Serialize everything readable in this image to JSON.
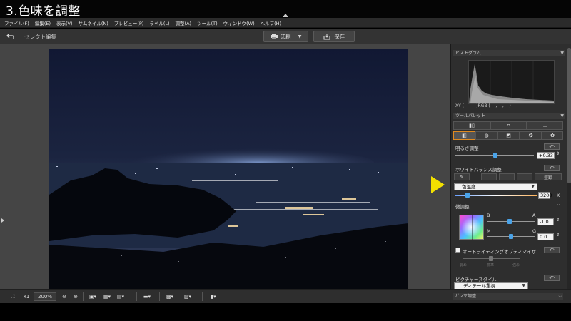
{
  "slide_title": "3.色味を調整",
  "menu": [
    "ファイル(F)",
    "編集(E)",
    "表示(V)",
    "サムネイル(N)",
    "プレビュー(P)",
    "ラベル(L)",
    "調整(A)",
    "ツール(T)",
    "ウィンドウ(W)",
    "ヘルプ(H)"
  ],
  "toolbar": {
    "mode_label": "セレクト編集",
    "print_label": "印刷",
    "save_label": "保存"
  },
  "histogram_panel": {
    "title": "ヒストグラム",
    "readout": "XY (    ,    )RGB (    ,    ,    )"
  },
  "tool_palette": {
    "title": "ツールパレット"
  },
  "brightness": {
    "label": "明るさ調整",
    "value": "+0.33",
    "level": 0.55
  },
  "white_balance": {
    "label": "ホワイトバランス調整",
    "register_label": "登録",
    "mode": "色温度",
    "temp_value": "3200",
    "temp_unit": "K",
    "temp_level": 0.12
  },
  "fine_adjust": {
    "label": "微調整",
    "b_label": "B",
    "a_label": "A",
    "ba_value": "-1.0",
    "ba_level": 0.43,
    "m_label": "M",
    "g_label": "G",
    "mg_value": "0.0",
    "mg_level": 0.5
  },
  "auto_lighting": {
    "label": "オートライティングオプティマイザ",
    "levels": [
      "弱め",
      "標準",
      "強め"
    ]
  },
  "picture_style": {
    "label": "ピクチャースタイル",
    "selected": "ディテール重視"
  },
  "gamma": {
    "label": "ガンマ調整"
  },
  "bottom_toolbar": {
    "zoom_one": "x1",
    "zoom_value": "200%"
  },
  "colors": {
    "accent": "#4aa3e8",
    "highlight": "#e08a1f",
    "pointer": "#f2e000"
  }
}
